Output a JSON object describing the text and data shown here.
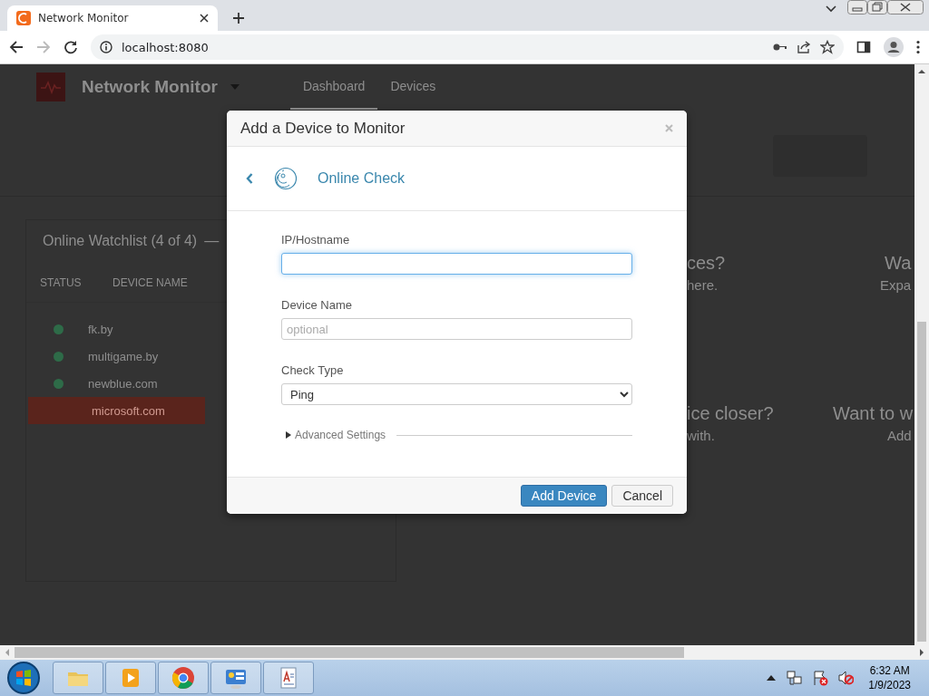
{
  "browser": {
    "tab": {
      "title": "Network Monitor",
      "selected": true
    },
    "address": "localhost:8080",
    "forward_disabled": true
  },
  "app": {
    "title": "Network Monitor",
    "nav": [
      {
        "label": "Dashboard",
        "selected": true
      },
      {
        "label": "Devices",
        "selected": false
      }
    ]
  },
  "watchlist": {
    "title": "Online Watchlist (4 of 4)",
    "collapse": "—",
    "columns": [
      "STATUS",
      "DEVICE NAME"
    ],
    "rows": [
      {
        "name": "fk.by",
        "kind": "online"
      },
      {
        "name": "multigame.by",
        "kind": "online"
      },
      {
        "name": "newblue.com",
        "kind": "online"
      },
      {
        "name": "microsoft.com",
        "kind": "offline"
      }
    ]
  },
  "tips": [
    {
      "title": "ces?",
      "text": "here."
    },
    {
      "title": "Wa",
      "text": "Expa"
    },
    {
      "title": "ice closer?",
      "text": "with."
    },
    {
      "title": "Want to w",
      "text": "Add"
    }
  ],
  "dialog": {
    "title": "Add a Device to Monitor",
    "check": "Online Check",
    "fields": [
      {
        "kind": "text",
        "label": "IP/Hostname",
        "focused": true
      },
      {
        "kind": "text",
        "label": "Device Name",
        "placeholder": "optional",
        "focused": false
      },
      {
        "kind": "select",
        "label": "Check Type",
        "value": "Ping"
      }
    ],
    "advanced": {
      "label": "Advanced Settings",
      "expanded": false
    },
    "buttons": [
      {
        "label": "Add Device",
        "primary": true
      },
      {
        "label": "Cancel",
        "primary": false
      }
    ]
  },
  "taskbar": {
    "time": "6:32 AM",
    "date": "1/9/2023"
  }
}
